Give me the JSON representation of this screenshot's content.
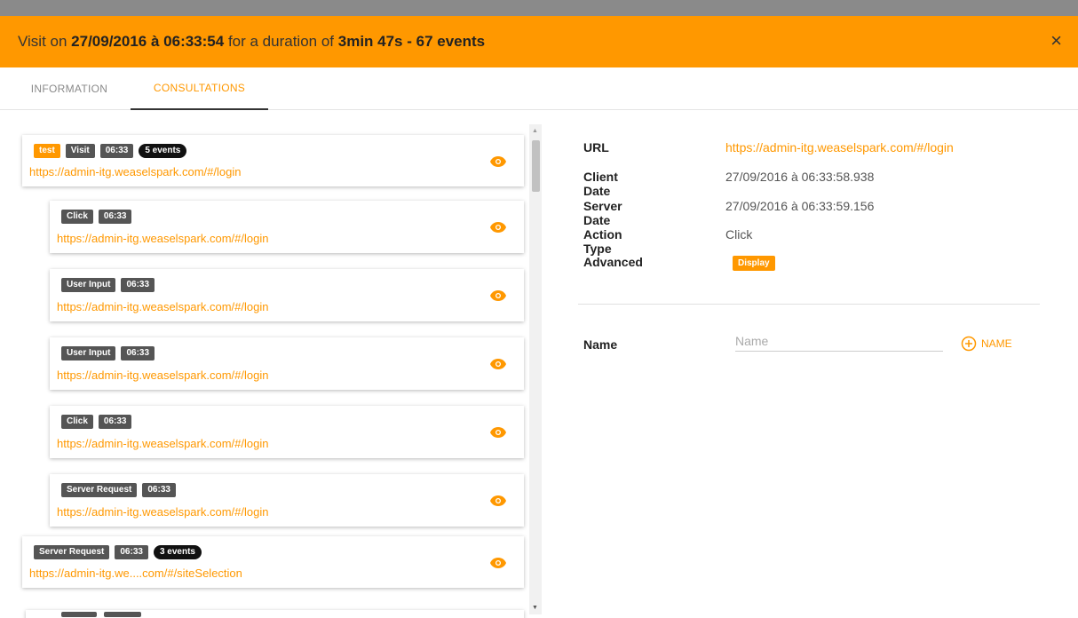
{
  "header": {
    "prefix": "Visit on ",
    "datetime": "27/09/2016 à 06:33:54",
    "middle": " for a duration of ",
    "duration_events": "3min 47s - 67 events",
    "close_icon": "×"
  },
  "tabs": [
    {
      "label": "INFORMATION"
    },
    {
      "label": "CONSULTATIONS"
    }
  ],
  "list": {
    "cards": [
      {
        "badges": [
          {
            "text": "test",
            "style": "orange"
          },
          {
            "text": "Visit"
          },
          {
            "text": "06:33"
          },
          {
            "text": "5 events",
            "style": "pill"
          }
        ],
        "url": "https://admin-itg.weaselspark.com/#/login"
      },
      {
        "badges": [
          {
            "text": "Click"
          },
          {
            "text": "06:33"
          }
        ],
        "url": "https://admin-itg.weaselspark.com/#/login"
      },
      {
        "badges": [
          {
            "text": "User Input"
          },
          {
            "text": "06:33"
          }
        ],
        "url": "https://admin-itg.weaselspark.com/#/login"
      },
      {
        "badges": [
          {
            "text": "User Input"
          },
          {
            "text": "06:33"
          }
        ],
        "url": "https://admin-itg.weaselspark.com/#/login"
      },
      {
        "badges": [
          {
            "text": "Click"
          },
          {
            "text": "06:33"
          }
        ],
        "url": "https://admin-itg.weaselspark.com/#/login"
      },
      {
        "badges": [
          {
            "text": "Server Request"
          },
          {
            "text": "06:33"
          }
        ],
        "url": "https://admin-itg.weaselspark.com/#/login"
      },
      {
        "badges": [
          {
            "text": "Server Request"
          },
          {
            "text": "06:33"
          },
          {
            "text": "3 events",
            "style": "pill"
          }
        ],
        "url": "https://admin-itg.we....com/#/siteSelection"
      }
    ],
    "eye_icon": "eye-icon"
  },
  "details": {
    "url_label": "URL",
    "url_value": "https://admin-itg.weaselspark.com/#/login",
    "client_date_label": "Client Date",
    "client_date_value": "27/09/2016 à 06:33:58.938",
    "server_date_label": "Server Date",
    "server_date_value": "27/09/2016 à 06:33:59.156",
    "action_type_label": "Action Type",
    "action_type_value": "Click",
    "advanced_label": "Advanced",
    "display_button": "Display"
  },
  "name_section": {
    "label": "Name",
    "placeholder": "Name",
    "add_button": "NAME"
  },
  "colors": {
    "accent": "#ff9800",
    "badge": "#555555",
    "pill": "#111111"
  }
}
